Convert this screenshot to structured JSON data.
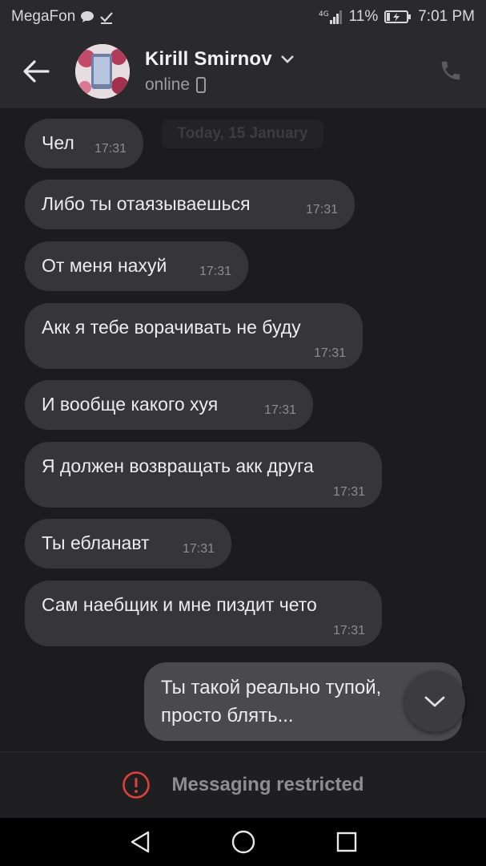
{
  "status_bar": {
    "carrier": "MegaFon",
    "network": "4G",
    "battery": "11%",
    "time": "7:01 PM"
  },
  "header": {
    "contact_name": "Kirill Smirnov",
    "status": "online"
  },
  "chat": {
    "date_chip": "Today, 15 January",
    "incoming": [
      {
        "text": "Чел",
        "time": "17:31"
      },
      {
        "text": "Либо ты отаязываешься",
        "time": "17:31"
      },
      {
        "text": "От меня нахуй",
        "time": "17:31"
      },
      {
        "text": "Акк я тебе ворачивать не буду",
        "time": "17:31"
      },
      {
        "text": "И вообще какого хуя",
        "time": "17:31"
      },
      {
        "text": "Я должен возвращать акк друга",
        "time": "17:31"
      },
      {
        "text": "Ты ебланавт",
        "time": "17:31"
      },
      {
        "text": "Сам наебщик и мне пиздит чето",
        "time": "17:31"
      }
    ],
    "outgoing": {
      "line1": "Ты такой реально тупой,",
      "line2": "просто блять..."
    }
  },
  "footer": {
    "restricted_label": "Messaging restricted"
  },
  "colors": {
    "background": "#1c1c1e",
    "incoming_bubble": "#363638",
    "outgoing_bubble": "#4a4a4d",
    "restricted_icon": "#e0403a"
  }
}
